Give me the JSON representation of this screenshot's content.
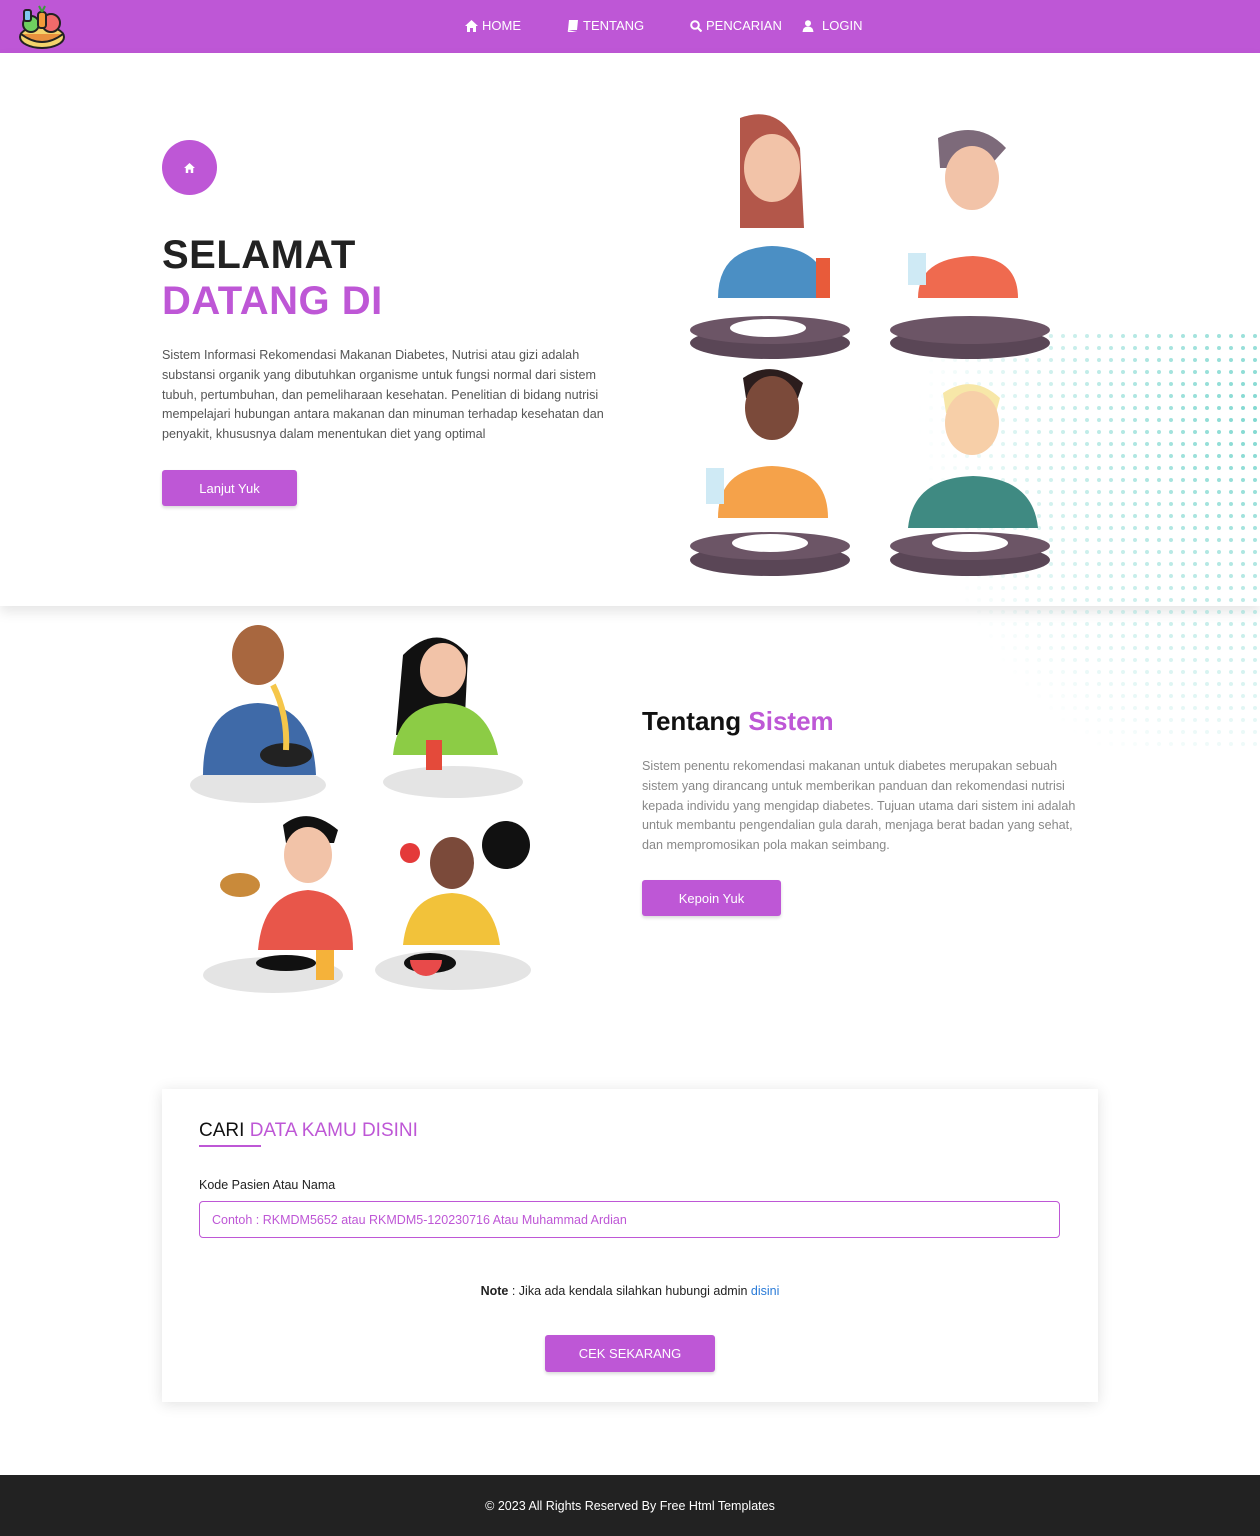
{
  "nav": {
    "items": [
      {
        "label": "HOME",
        "icon": "home-icon"
      },
      {
        "label": "TENTANG",
        "icon": "book-icon"
      },
      {
        "label": "PENCARIAN",
        "icon": "search-icon"
      },
      {
        "label": "LOGIN",
        "icon": "user-icon"
      }
    ]
  },
  "hero": {
    "title_line1": "SELAMAT",
    "title_line2": "DATANG DI",
    "description": "Sistem Informasi Rekomendasi Makanan Diabetes, Nutrisi atau gizi adalah substansi organik yang dibutuhkan organisme untuk fungsi normal dari sistem tubuh, pertumbuhan, dan pemeliharaan kesehatan. Penelitian di bidang nutrisi mempelajari hubungan antara makanan dan minuman terhadap kesehatan dan penyakit, khususnya dalam menentukan diet yang optimal",
    "button_label": "Lanjut Yuk"
  },
  "about": {
    "title_plain": "Tentang ",
    "title_accent": "Sistem",
    "description": "Sistem penentu rekomendasi makanan untuk diabetes merupakan sebuah sistem yang dirancang untuk memberikan panduan dan rekomendasi nutrisi kepada individu yang mengidap diabetes. Tujuan utama dari sistem ini adalah untuk membantu pengendalian gula darah, menjaga berat badan yang sehat, dan mempromosikan pola makan seimbang.",
    "button_label": "Kepoin Yuk"
  },
  "search": {
    "title_plain": "CARI ",
    "title_accent": "DATA KAMU DISINI",
    "field_label": "Kode Pasien Atau Nama",
    "placeholder": "Contoh : RKMDM5652 atau RKMDM5-120230716 Atau Muhammad Ardian",
    "note_bold": "Note",
    "note_text": " : Jika ada kendala silahkan hubungi admin ",
    "note_link": "disini",
    "button_label": "CEK SEKARANG"
  },
  "footer": {
    "text": "© 2023 All Rights Reserved By Free Html Templates"
  },
  "colors": {
    "accent": "#be57d6",
    "footer_bg": "#222222",
    "link": "#2a7bd8"
  }
}
